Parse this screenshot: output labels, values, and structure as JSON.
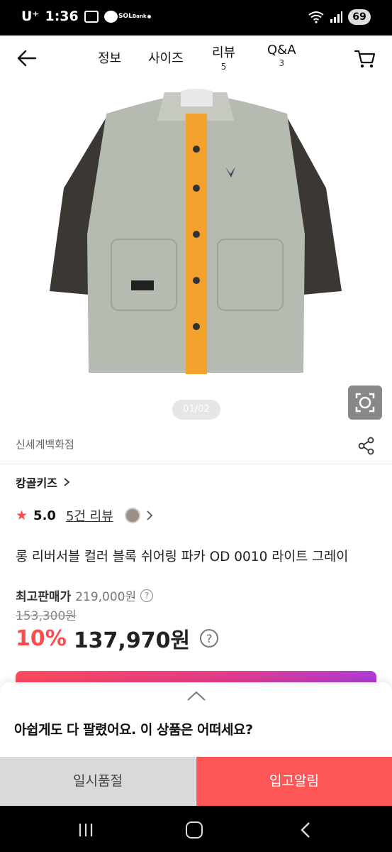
{
  "status_bar": {
    "carrier": "U⁺",
    "time": "1:36",
    "sol_label": "SOL",
    "bank_label": "Bank",
    "battery": "69",
    "icons": [
      "kakao-talk-icon",
      "chat-bubble-icon",
      "sol-bank-icon",
      "wifi-icon",
      "signal-icon",
      "battery-icon"
    ]
  },
  "header": {
    "tabs": [
      {
        "label": "정보",
        "count": ""
      },
      {
        "label": "사이즈",
        "count": ""
      },
      {
        "label": "리뷰",
        "count": "5"
      },
      {
        "label": "Q&A",
        "count": "3"
      }
    ]
  },
  "gallery": {
    "pager": "01/02",
    "image_alt": "product-jacket"
  },
  "store": {
    "name": "신세계백화점"
  },
  "brand": {
    "name": "캉골키즈"
  },
  "rating": {
    "score": "5.0",
    "reviews": "5건 리뷰"
  },
  "product": {
    "title": "롱 리버서블 컬러 블록 쉬어링 파카 OD 0010 라이트 그레이",
    "max_price_label": "최고판매가",
    "max_price": "219,000원",
    "original_price": "153,300원",
    "discount": "10%",
    "sale_price": "137,970원"
  },
  "sheet": {
    "message": "아쉽게도 다 팔렸어요. 이 상품은 어떠세요?",
    "soldout_label": "일시품절",
    "notify_label": "입고알림"
  },
  "colors": {
    "accent": "#ff5757",
    "discount": "#ff4b4b",
    "soldout_bg": "#d9d9d9"
  }
}
